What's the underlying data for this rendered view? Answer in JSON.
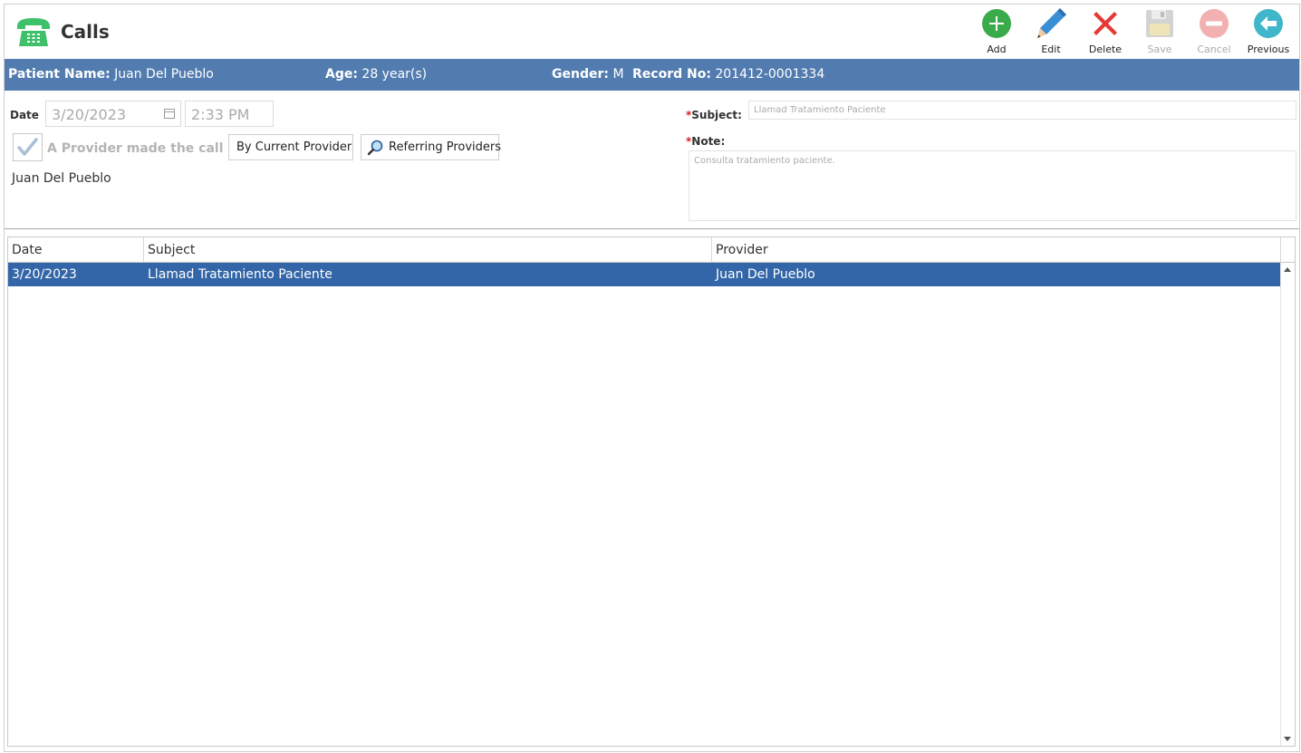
{
  "header": {
    "title": "Calls",
    "app_icon": "telephone-icon"
  },
  "toolbar": {
    "add_label": "Add",
    "edit_label": "Edit",
    "delete_label": "Delete",
    "save_label": "Save",
    "cancel_label": "Cancel",
    "previous_label": "Previous"
  },
  "patient": {
    "name_label": "Patient Name:",
    "name": "Juan Del Pueblo",
    "age_label": "Age:",
    "age": "28 year(s)",
    "gender_label": "Gender:",
    "gender": "M",
    "record_label": "Record No:",
    "record": "201412-0001334"
  },
  "form": {
    "date_label": "Date",
    "date_value": "3/20/2023",
    "time_value": "2:33 PM",
    "provider_check_label": "A Provider made the call",
    "provider_checked": true,
    "by_current_provider_label": "By Current Provider",
    "referring_providers_label": "Referring Providers",
    "provider_name": "Juan  Del Pueblo",
    "required_mark": "*",
    "subject_label": "Subject:",
    "subject_value": "Llamad Tratamiento Paciente",
    "note_label": "Note:",
    "note_value": "Consulta tratamiento paciente."
  },
  "grid": {
    "columns": [
      "Date",
      "Subject",
      "Provider"
    ],
    "rows": [
      {
        "date": "3/20/2023",
        "subject": "Llamad Tratamiento Paciente",
        "provider": "Juan  Del Pueblo",
        "selected": true
      }
    ]
  },
  "colors": {
    "patient_bar": "#527cb0",
    "selected_row": "#3366a8",
    "add_green": "#3aab4a",
    "edit_blue": "#3a8ed6",
    "delete_red": "#e53935",
    "previous_teal": "#3fb6c9",
    "required_red": "#d81e1e"
  }
}
